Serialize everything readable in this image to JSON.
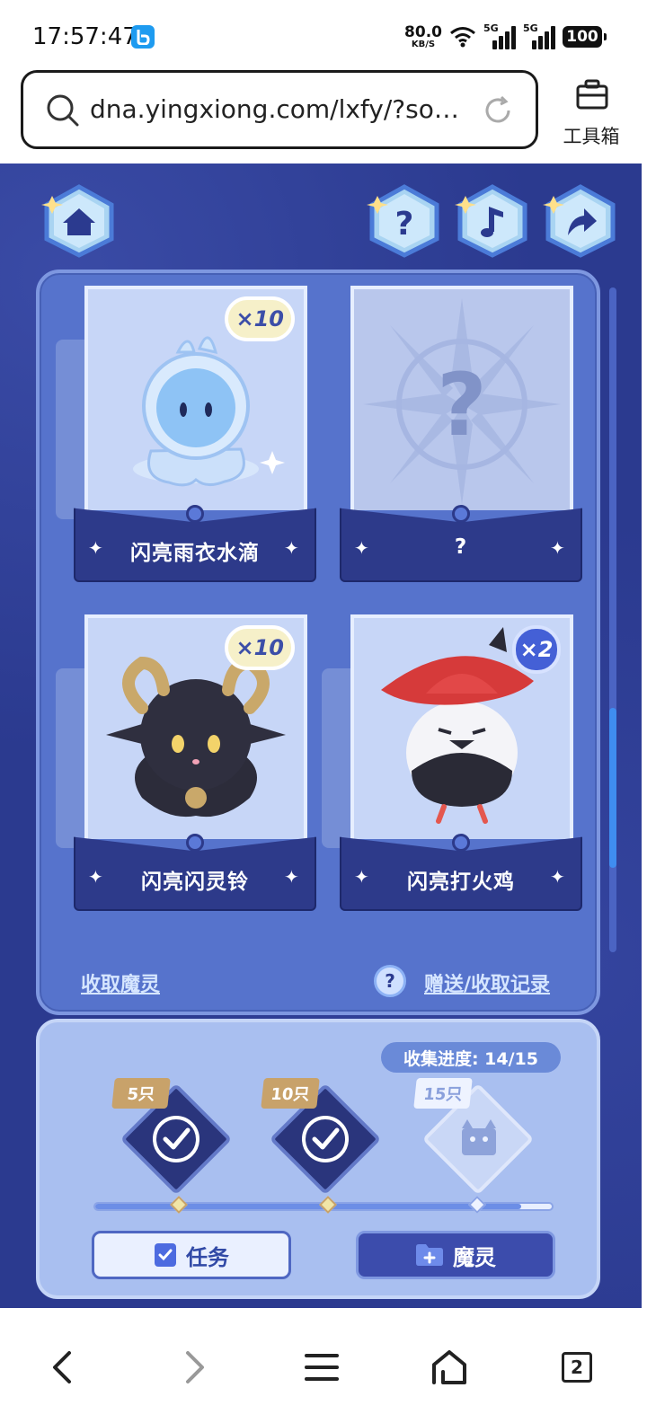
{
  "status": {
    "time": "17:57:47",
    "net_speed": "80.0",
    "net_unit": "KB/S",
    "sim1": "5G",
    "sim2": "5G",
    "battery": "100"
  },
  "browser": {
    "url": "dna.yingxiong.com/lxfy/?sourc...",
    "toolbox_label": "工具箱",
    "tab_count": "2"
  },
  "game": {
    "cards": [
      {
        "name": "闪亮雨衣水滴",
        "count": "×10"
      },
      {
        "name": "?",
        "count": ""
      },
      {
        "name": "闪亮闪灵铃",
        "count": "×10"
      },
      {
        "name": "闪亮打火鸡",
        "count": "×2"
      }
    ],
    "collect_link": "收取魔灵",
    "info_icon": "?",
    "records_link": "赠送/收取记录",
    "progress_label": "收集进度: 14/15",
    "progress": {
      "current": 14,
      "total": 15
    },
    "milestones": [
      {
        "label": "5只",
        "completed": true
      },
      {
        "label": "10只",
        "completed": true
      },
      {
        "label": "15只",
        "completed": false
      }
    ],
    "task_button": "任务",
    "spirit_button": "魔灵"
  },
  "icons": {
    "home": "home-icon",
    "help": "question-icon",
    "music": "music-note-icon",
    "share": "share-arrow-icon"
  },
  "colors": {
    "game_bg": "#2b3a8f",
    "panel": "#5673cc",
    "accent": "#3f8df0"
  }
}
